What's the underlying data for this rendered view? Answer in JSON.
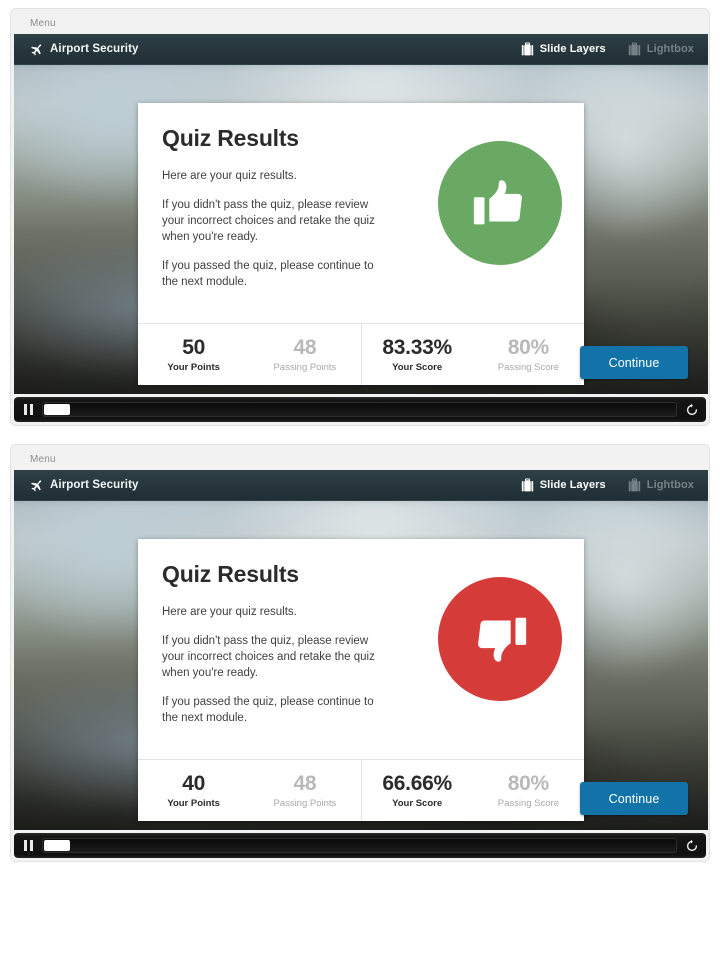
{
  "panels": [
    {
      "menu_label": "Menu",
      "header": {
        "plane_icon": "airplane-icon",
        "course_title": "Airport Security",
        "slide_layers_label": "Slide Layers",
        "slide_layers_icon": "suitcase-icon",
        "lightbox_label": "Lightbox",
        "lightbox_icon": "suitcase-icon"
      },
      "card": {
        "heading": "Quiz Results",
        "paragraph1": "Here are your quiz results.",
        "paragraph2": "If you didn't pass the quiz, please review your incorrect choices and retake the quiz when you're ready.",
        "paragraph3": "If you passed the quiz, please continue to the next module.",
        "badge_icon": "thumbs-up-icon",
        "badge_color": "#6aa964",
        "scores": [
          {
            "value": "50",
            "label": "Your Points",
            "style": "primary"
          },
          {
            "value": "48",
            "label": "Passing Points",
            "style": "muted"
          },
          {
            "value": "83.33%",
            "label": "Your Score",
            "style": "primary"
          },
          {
            "value": "80%",
            "label": "Passing Score",
            "style": "muted"
          }
        ]
      },
      "continue_label": "Continue",
      "continue_color": "#1273a8",
      "playbar": {
        "pause_icon": "pause-icon",
        "replay_icon": "replay-icon",
        "progress_percent": 4
      }
    },
    {
      "menu_label": "Menu",
      "header": {
        "plane_icon": "airplane-icon",
        "course_title": "Airport Security",
        "slide_layers_label": "Slide Layers",
        "slide_layers_icon": "suitcase-icon",
        "lightbox_label": "Lightbox",
        "lightbox_icon": "suitcase-icon"
      },
      "card": {
        "heading": "Quiz Results",
        "paragraph1": "Here are your quiz results.",
        "paragraph2": "If you didn't pass the quiz, please review your incorrect choices and retake the quiz when you're ready.",
        "paragraph3": "If you passed the quiz, please continue to the next module.",
        "badge_icon": "thumbs-down-icon",
        "badge_color": "#d53b38",
        "scores": [
          {
            "value": "40",
            "label": "Your Points",
            "style": "primary"
          },
          {
            "value": "48",
            "label": "Passing Points",
            "style": "muted"
          },
          {
            "value": "66.66%",
            "label": "Your Score",
            "style": "primary"
          },
          {
            "value": "80%",
            "label": "Passing Score",
            "style": "muted"
          }
        ]
      },
      "continue_label": "Continue",
      "continue_color": "#1273a8",
      "playbar": {
        "pause_icon": "pause-icon",
        "replay_icon": "replay-icon",
        "progress_percent": 4
      }
    }
  ]
}
